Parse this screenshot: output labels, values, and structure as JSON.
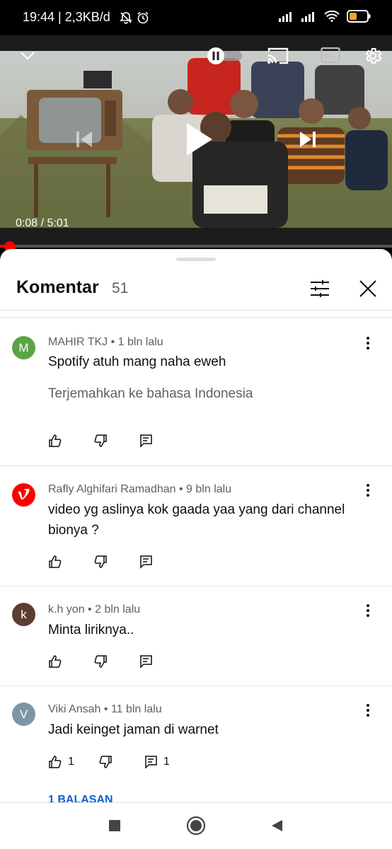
{
  "status_bar": {
    "time": "19:44",
    "net_speed": "2,3KB/d",
    "icons": [
      "mute-icon",
      "alarm-icon",
      "signal-icon",
      "signal-icon",
      "wifi-icon",
      "battery-icon"
    ]
  },
  "player": {
    "time_current": "0:08",
    "time_total": "5:01",
    "time_sep": " / ",
    "progress": 0.027,
    "icons": [
      "chevron-down-icon",
      "autoplay-toggle-icon",
      "cast-icon",
      "captions-icon",
      "settings-icon",
      "previous-icon",
      "play-icon",
      "next-icon"
    ]
  },
  "comments_panel": {
    "title": "Komentar",
    "count": "51",
    "comments": [
      {
        "author": "MAHIR TKJ",
        "age": "1 bln lalu",
        "avatar_letter": "M",
        "avatar_color": "#5aa543",
        "text": "Spotify atuh mang naha eweh",
        "translate": "Terjemahkan ke bahasa Indonesia",
        "likes": "",
        "replies": ""
      },
      {
        "author": "Rafly Alghifari Ramadhan",
        "age": "9 bln lalu",
        "avatar_letter": "",
        "avatar_color": "#ff0000",
        "text": "video yg aslinya kok gaada yaa yang dari channel bionya ?",
        "likes": "",
        "replies": ""
      },
      {
        "author": "k.h yon",
        "age": "2 bln lalu",
        "avatar_letter": "k",
        "avatar_color": "#5d3c34",
        "text": "Minta liriknya..",
        "likes": "",
        "replies": ""
      },
      {
        "author": "Viki Ansah",
        "age": "11 bln lalu",
        "avatar_letter": "V",
        "avatar_color": "#7b97a6",
        "text": "Jadi keinget jaman di warnet",
        "likes": "1",
        "replies": "1",
        "reply_link": "1 BALASAN"
      }
    ]
  },
  "colors": {
    "accent": "#ff0000",
    "link": "#065fd4"
  }
}
